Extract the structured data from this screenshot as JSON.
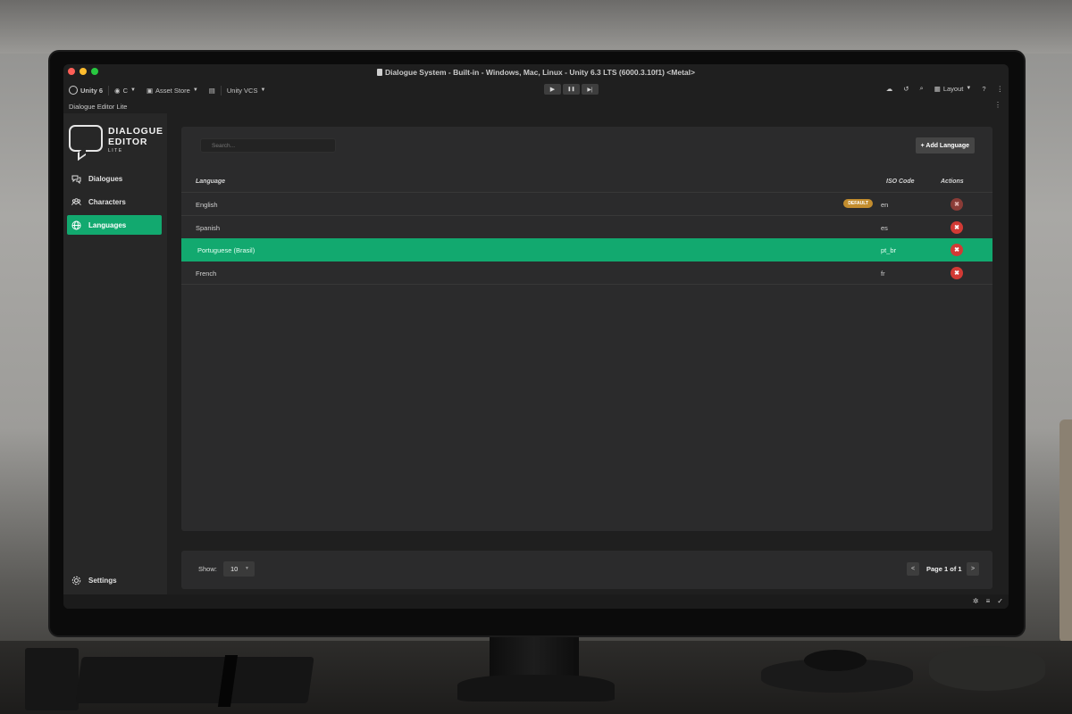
{
  "window": {
    "title": "Dialogue System - Built-in - Windows, Mac, Linux - Unity 6.3 LTS (6000.3.10f1) <Metal>",
    "traffic_colors": {
      "close": "#ff5f57",
      "minimize": "#febc2e",
      "zoom": "#28c840"
    }
  },
  "toolbar": {
    "unity_label": "Unity 6",
    "account_label": "C",
    "asset_store_label": "Asset Store",
    "vcs_label": "Unity VCS",
    "play_icon": "▶",
    "pause_icon": "❚❚",
    "step_icon": "▶|",
    "layout_label": "Layout",
    "right_icons": [
      "cloud-icon",
      "history-icon",
      "search-icon",
      "layout-icon",
      "help-icon",
      "more-icon"
    ]
  },
  "editor_tab": {
    "title": "Dialogue Editor Lite",
    "menu_icon": "⋮"
  },
  "sidebar": {
    "logo_line1": "DIALOGUE",
    "logo_line2": "EDITOR",
    "logo_sub": "LITE",
    "items": [
      {
        "label": "Dialogues",
        "icon": "chat-bubbles-icon",
        "active": false
      },
      {
        "label": "Characters",
        "icon": "characters-icon",
        "active": false
      },
      {
        "label": "Languages",
        "icon": "globe-icon",
        "active": true
      }
    ],
    "settings_label": "Settings",
    "accent": "#12a96f"
  },
  "languages": {
    "search_placeholder": "Search...",
    "add_button": "+ Add Language",
    "columns": {
      "language": "Language",
      "iso": "ISO Code",
      "actions": "Actions"
    },
    "rows": [
      {
        "name": "English",
        "iso": "en",
        "badge": "DEFAULT",
        "selected": false
      },
      {
        "name": "Spanish",
        "iso": "es",
        "badge": "",
        "selected": false
      },
      {
        "name": "Portuguese (Brasil)",
        "iso": "pt_br",
        "badge": "",
        "selected": true
      },
      {
        "name": "French",
        "iso": "fr",
        "badge": "",
        "selected": false
      }
    ],
    "delete_icon": "✖"
  },
  "pagination": {
    "show_label": "Show:",
    "page_size": "10",
    "prev": "<",
    "page_label": "Page 1 of 1",
    "next": ">"
  }
}
